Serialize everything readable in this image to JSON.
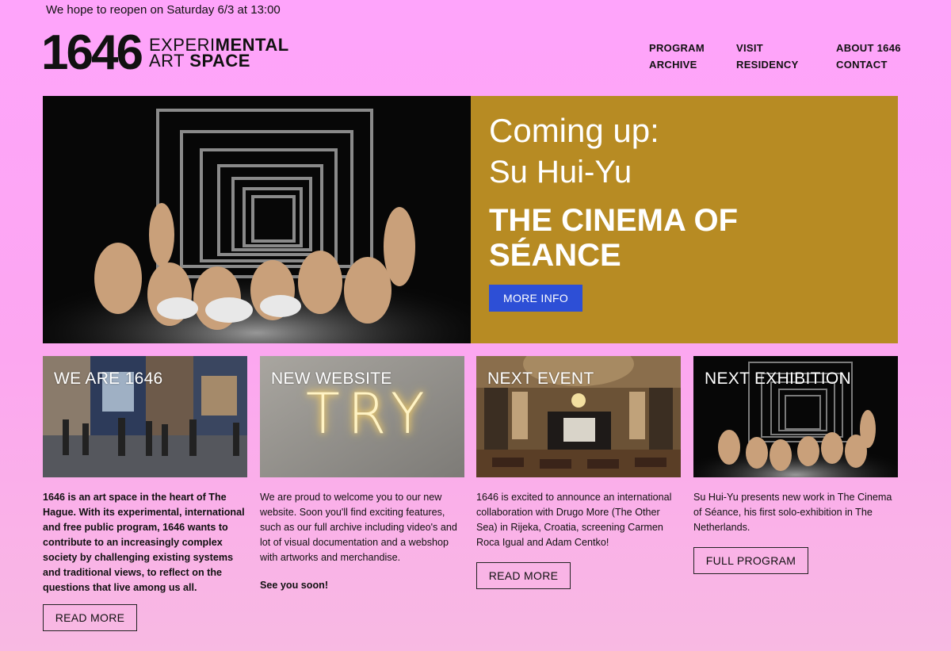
{
  "notice": "We hope to reopen on Saturday 6/3 at 13:00",
  "logo": {
    "number": "1646",
    "line1_light": "EXPERI",
    "line1_bold": "MENTAL",
    "line2_light": "ART ",
    "line2_bold": "SPACE"
  },
  "nav": {
    "col1": [
      "PROGRAM",
      "ARCHIVE"
    ],
    "col2": [
      "VISIT",
      "RESIDENCY"
    ],
    "col3": [
      "ABOUT 1646",
      "CONTACT"
    ]
  },
  "hero": {
    "kicker": "Coming up:",
    "artist": "Su Hui-Yu",
    "title": "THE CINEMA OF SÉANCE",
    "button": "MORE INFO",
    "panel_color": "#b78b23",
    "button_color": "#2d4fd6"
  },
  "cards": [
    {
      "label": "WE ARE 1646",
      "text": "1646 is an art space in the heart of The Hague. With its experimental, international and free public program, 1646 wants to contribute to an increasingly complex society by challenging existing systems and traditional views, to reflect on the questions that live among us all.",
      "button": "READ MORE"
    },
    {
      "label": "NEW WEBSITE",
      "text": "We are proud to welcome you to our new website. Soon you'll find exciting features, such as our full archive including video's and lot of visual documentation and a webshop with artworks and merchandise.",
      "extra": "See you soon!",
      "neon": "TRY"
    },
    {
      "label": "NEXT EVENT",
      "text": "1646 is excited to announce an international collaboration with Drugo More (The Other Sea) in Rijeka, Croatia, screening Carmen Roca Igual and Adam Centko!",
      "button": "READ MORE"
    },
    {
      "label": "NEXT EXHIBITION",
      "text": "Su Hui-Yu presents new work in The Cinema of Séance, his first solo-exhibition in The Netherlands.",
      "button": "FULL PROGRAM"
    }
  ]
}
